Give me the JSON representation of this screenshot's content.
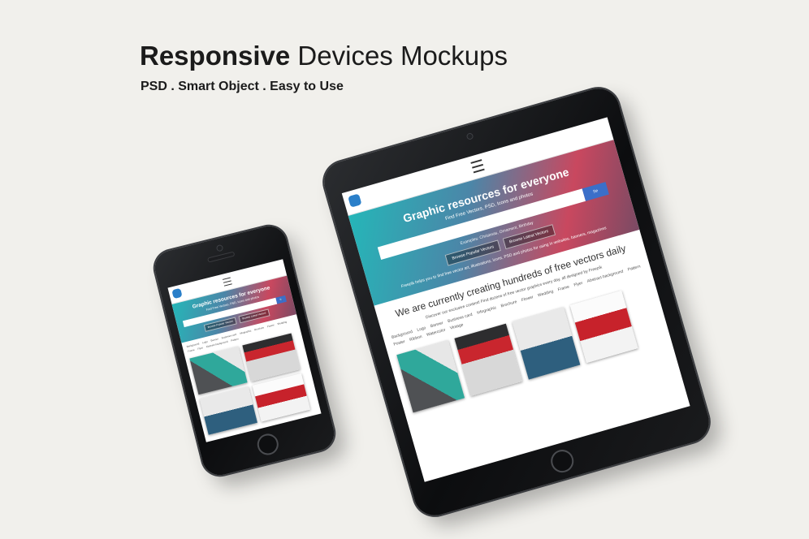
{
  "headline": {
    "bold": "Responsive",
    "rest": "Devices Mockups"
  },
  "subhead": "PSD . Smart Object . Easy to Use",
  "site": {
    "hero_title": "Graphic resources for everyone",
    "hero_sub": "Find Free Vectors, PSD, Icons and photos",
    "search_button": "Se",
    "examples": "Examples: Christmas, Ornament, Birthday",
    "btn_popular": "Browse Popular Vectors",
    "btn_latest": "Browse Latest Vectors",
    "hero_desc": "Freepik helps you to find free vector art, illustrations, icons, PSD and photos for using in websites, banners, magazines",
    "section_title": "We are currently creating hundreds of free vectors daily",
    "section_text": "Discover our exclusive content! Find dozens of free vector graphics every day, all designed by Freepik",
    "tags": [
      "Background",
      "Logo",
      "Banner",
      "Business card",
      "Infographic",
      "Brochure",
      "Flower",
      "Wedding",
      "Frame",
      "Flyer",
      "Abstract background",
      "Pattern",
      "Poster",
      "Ribbon",
      "Watercolor",
      "Vintage"
    ]
  },
  "colors": {
    "background": "#f1f0ec",
    "device": "#111214",
    "accent": "#3b6fc9"
  }
}
